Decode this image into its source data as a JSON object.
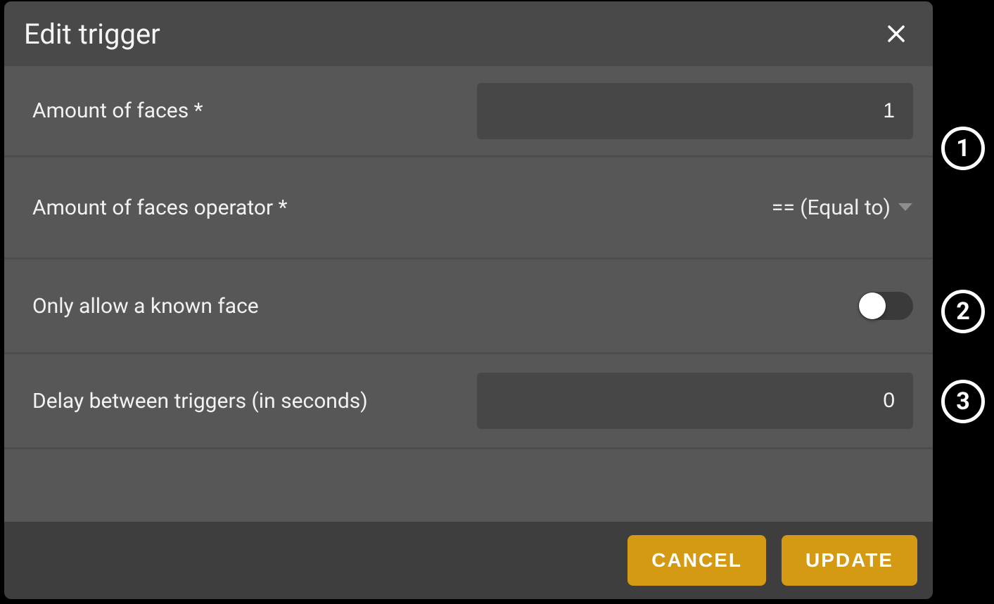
{
  "dialog": {
    "title": "Edit trigger"
  },
  "form": {
    "faces": {
      "label": "Amount of faces *",
      "value": "1"
    },
    "operator": {
      "label": "Amount of faces operator *",
      "value": "== (Equal to)"
    },
    "knownFace": {
      "label": "Only allow a known face",
      "checked": false
    },
    "delay": {
      "label": "Delay between triggers (in seconds)",
      "value": "0"
    }
  },
  "footer": {
    "cancel": "CANCEL",
    "update": "UPDATE"
  },
  "annotations": {
    "1": "1",
    "2": "2",
    "3": "3"
  }
}
